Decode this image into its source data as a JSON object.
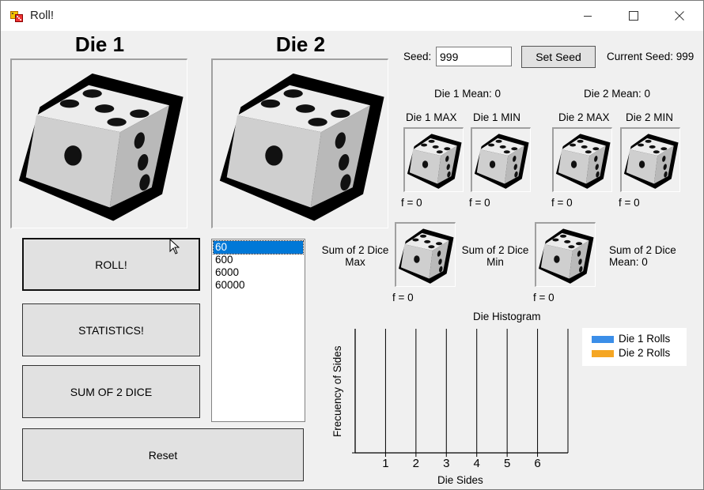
{
  "window": {
    "title": "Roll!"
  },
  "die1": {
    "heading": "Die 1"
  },
  "die2": {
    "heading": "Die 2"
  },
  "buttons": {
    "roll": "ROLL!",
    "statistics": "STATISTICS!",
    "sum": "SUM OF 2 DICE",
    "reset": "Reset",
    "set_seed": "Set Seed"
  },
  "rolls_list": {
    "items": [
      "60",
      "600",
      "6000",
      "60000"
    ],
    "selected": "60"
  },
  "seed": {
    "label": "Seed:",
    "value": "999",
    "current": "Current Seed: 999"
  },
  "stats": {
    "die1_mean": "Die 1 Mean: 0",
    "die2_mean": "Die 2 Mean: 0",
    "die1_max": "Die 1 MAX",
    "die1_min": "Die 1 MIN",
    "die2_max": "Die 2 MAX",
    "die2_min": "Die 2 MIN",
    "f_die1_max": "f = 0",
    "f_die1_min": "f = 0",
    "f_die2_max": "f = 0",
    "f_die2_min": "f = 0",
    "sum_max_l1": "Sum of 2 Dice",
    "sum_max_l2": "Max",
    "sum_min_l1": "Sum of 2 Dice",
    "sum_min_l2": "Min",
    "sum_mean_l1": "Sum of 2 Dice",
    "sum_mean_l2": "Mean: 0",
    "f_sum_max": "f = 0",
    "f_sum_min": "f = 0"
  },
  "chart_data": {
    "type": "bar",
    "title": "Die Histogram",
    "xlabel": "Die Sides",
    "ylabel": "Frecuency of Sides",
    "categories": [
      "1",
      "2",
      "3",
      "4",
      "5",
      "6"
    ],
    "series": [
      {
        "name": "Die 1 Rolls",
        "color": "#3b8ee8",
        "values": [
          0,
          0,
          0,
          0,
          0,
          0
        ]
      },
      {
        "name": "Die 2 Rolls",
        "color": "#f5a623",
        "values": [
          0,
          0,
          0,
          0,
          0,
          0
        ]
      }
    ],
    "legend": "top-right",
    "grid": true
  },
  "icons": [
    "app-dice-icon",
    "minimize-icon",
    "maximize-icon",
    "close-icon",
    "die-face-icon",
    "mouse-cursor-icon"
  ]
}
